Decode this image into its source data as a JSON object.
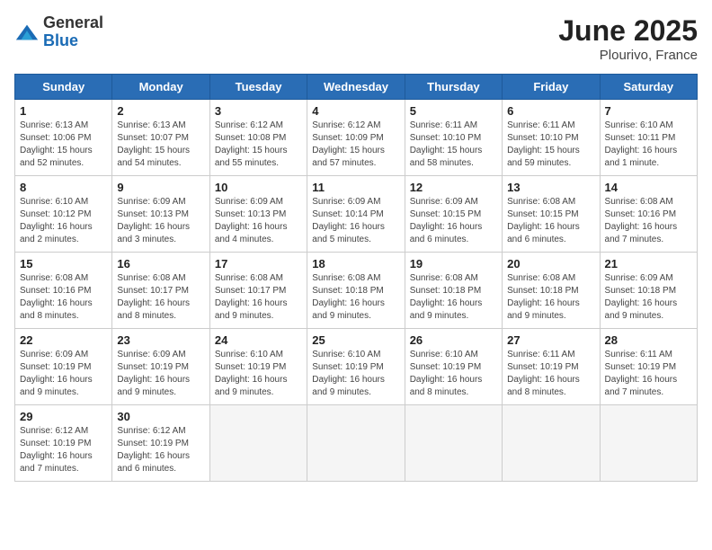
{
  "header": {
    "logo_line1": "General",
    "logo_line2": "Blue",
    "title": "June 2025",
    "subtitle": "Plourivo, France"
  },
  "columns": [
    "Sunday",
    "Monday",
    "Tuesday",
    "Wednesday",
    "Thursday",
    "Friday",
    "Saturday"
  ],
  "weeks": [
    [
      {
        "day": "1",
        "detail": "Sunrise: 6:13 AM\nSunset: 10:06 PM\nDaylight: 15 hours\nand 52 minutes."
      },
      {
        "day": "2",
        "detail": "Sunrise: 6:13 AM\nSunset: 10:07 PM\nDaylight: 15 hours\nand 54 minutes."
      },
      {
        "day": "3",
        "detail": "Sunrise: 6:12 AM\nSunset: 10:08 PM\nDaylight: 15 hours\nand 55 minutes."
      },
      {
        "day": "4",
        "detail": "Sunrise: 6:12 AM\nSunset: 10:09 PM\nDaylight: 15 hours\nand 57 minutes."
      },
      {
        "day": "5",
        "detail": "Sunrise: 6:11 AM\nSunset: 10:10 PM\nDaylight: 15 hours\nand 58 minutes."
      },
      {
        "day": "6",
        "detail": "Sunrise: 6:11 AM\nSunset: 10:10 PM\nDaylight: 15 hours\nand 59 minutes."
      },
      {
        "day": "7",
        "detail": "Sunrise: 6:10 AM\nSunset: 10:11 PM\nDaylight: 16 hours\nand 1 minute."
      }
    ],
    [
      {
        "day": "8",
        "detail": "Sunrise: 6:10 AM\nSunset: 10:12 PM\nDaylight: 16 hours\nand 2 minutes."
      },
      {
        "day": "9",
        "detail": "Sunrise: 6:09 AM\nSunset: 10:13 PM\nDaylight: 16 hours\nand 3 minutes."
      },
      {
        "day": "10",
        "detail": "Sunrise: 6:09 AM\nSunset: 10:13 PM\nDaylight: 16 hours\nand 4 minutes."
      },
      {
        "day": "11",
        "detail": "Sunrise: 6:09 AM\nSunset: 10:14 PM\nDaylight: 16 hours\nand 5 minutes."
      },
      {
        "day": "12",
        "detail": "Sunrise: 6:09 AM\nSunset: 10:15 PM\nDaylight: 16 hours\nand 6 minutes."
      },
      {
        "day": "13",
        "detail": "Sunrise: 6:08 AM\nSunset: 10:15 PM\nDaylight: 16 hours\nand 6 minutes."
      },
      {
        "day": "14",
        "detail": "Sunrise: 6:08 AM\nSunset: 10:16 PM\nDaylight: 16 hours\nand 7 minutes."
      }
    ],
    [
      {
        "day": "15",
        "detail": "Sunrise: 6:08 AM\nSunset: 10:16 PM\nDaylight: 16 hours\nand 8 minutes."
      },
      {
        "day": "16",
        "detail": "Sunrise: 6:08 AM\nSunset: 10:17 PM\nDaylight: 16 hours\nand 8 minutes."
      },
      {
        "day": "17",
        "detail": "Sunrise: 6:08 AM\nSunset: 10:17 PM\nDaylight: 16 hours\nand 9 minutes."
      },
      {
        "day": "18",
        "detail": "Sunrise: 6:08 AM\nSunset: 10:18 PM\nDaylight: 16 hours\nand 9 minutes."
      },
      {
        "day": "19",
        "detail": "Sunrise: 6:08 AM\nSunset: 10:18 PM\nDaylight: 16 hours\nand 9 minutes."
      },
      {
        "day": "20",
        "detail": "Sunrise: 6:08 AM\nSunset: 10:18 PM\nDaylight: 16 hours\nand 9 minutes."
      },
      {
        "day": "21",
        "detail": "Sunrise: 6:09 AM\nSunset: 10:18 PM\nDaylight: 16 hours\nand 9 minutes."
      }
    ],
    [
      {
        "day": "22",
        "detail": "Sunrise: 6:09 AM\nSunset: 10:19 PM\nDaylight: 16 hours\nand 9 minutes."
      },
      {
        "day": "23",
        "detail": "Sunrise: 6:09 AM\nSunset: 10:19 PM\nDaylight: 16 hours\nand 9 minutes."
      },
      {
        "day": "24",
        "detail": "Sunrise: 6:10 AM\nSunset: 10:19 PM\nDaylight: 16 hours\nand 9 minutes."
      },
      {
        "day": "25",
        "detail": "Sunrise: 6:10 AM\nSunset: 10:19 PM\nDaylight: 16 hours\nand 9 minutes."
      },
      {
        "day": "26",
        "detail": "Sunrise: 6:10 AM\nSunset: 10:19 PM\nDaylight: 16 hours\nand 8 minutes."
      },
      {
        "day": "27",
        "detail": "Sunrise: 6:11 AM\nSunset: 10:19 PM\nDaylight: 16 hours\nand 8 minutes."
      },
      {
        "day": "28",
        "detail": "Sunrise: 6:11 AM\nSunset: 10:19 PM\nDaylight: 16 hours\nand 7 minutes."
      }
    ],
    [
      {
        "day": "29",
        "detail": "Sunrise: 6:12 AM\nSunset: 10:19 PM\nDaylight: 16 hours\nand 7 minutes."
      },
      {
        "day": "30",
        "detail": "Sunrise: 6:12 AM\nSunset: 10:19 PM\nDaylight: 16 hours\nand 6 minutes."
      },
      {
        "day": "",
        "detail": ""
      },
      {
        "day": "",
        "detail": ""
      },
      {
        "day": "",
        "detail": ""
      },
      {
        "day": "",
        "detail": ""
      },
      {
        "day": "",
        "detail": ""
      }
    ]
  ]
}
